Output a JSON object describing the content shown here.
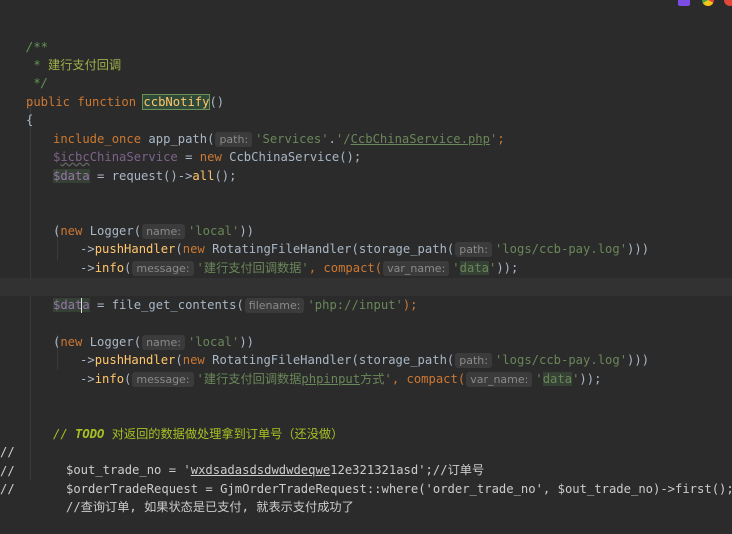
{
  "editor": {
    "doc_open": "/**",
    "doc_star": " * ",
    "doc_text": "建行支付回调",
    "doc_close": " */",
    "kw_public": "public",
    "kw_function": "function",
    "fn_name": "ccbNotify",
    "fn_parens": "()",
    "brace_open": "{",
    "line_include": {
      "kw": "include_once",
      "call": " app_path(",
      "hint": "path:",
      "str1": "'Services'",
      "concat": ".",
      "str2_quote": "'/",
      "str2_link": "CcbChinaService.php",
      "str2_close": "'",
      "end": ";"
    },
    "line_service": {
      "var_prefix": "$",
      "var_wavy": "icbc",
      "var_rest": "ChinaService",
      "eq": " = ",
      "kw_new": "new",
      "cls": " CcbChinaService();"
    },
    "line_request": {
      "var": "$data",
      "eq": " = request()->",
      "method": "all",
      "end": "();"
    },
    "logger1": {
      "open": "(",
      "kw_new": "new",
      "cls": " Logger(",
      "hint_name": "name:",
      "name_str": "'local'",
      "close": "))",
      "arrow1": "->",
      "m_push": "pushHandler",
      "push_open": "(",
      "kw_new2": "new",
      "handler": " RotatingFileHandler(storage_path(",
      "hint_path": "path:",
      "path_str": "'logs/ccb-pay.log'",
      "push_close": ")))",
      "arrow2": "->",
      "m_info": "info",
      "info_open": "(",
      "hint_msg": "message:",
      "msg_str": "'建行支付回调数据'",
      "comma": ", compact(",
      "hint_var": "var_name:",
      "var_q1": "'",
      "var_word": "data",
      "var_q2": "'",
      "info_close": "));"
    },
    "line_input": {
      "var_a": "$dat",
      "var_b": "a",
      "eq": " = file_get_contents(",
      "hint": "filename:",
      "str": "'php://input'",
      "end": ");"
    },
    "logger2": {
      "open": "(",
      "kw_new": "new",
      "cls": " Logger(",
      "hint_name": "name:",
      "name_str": "'local'",
      "close": "))",
      "arrow1": "->",
      "m_push": "pushHandler",
      "push_open": "(",
      "kw_new2": "new",
      "handler": " RotatingFileHandler(storage_path(",
      "hint_path": "path:",
      "path_str": "'logs/ccb-pay.log'",
      "push_close": ")))",
      "arrow2": "->",
      "m_info": "info",
      "info_open": "(",
      "hint_msg": "message:",
      "msg_str_a": "'建行支付回调数据",
      "msg_str_u": "phpinput",
      "msg_str_b": "方式'",
      "comma": ", compact(",
      "hint_var": "var_name:",
      "var_q1": "'",
      "var_word": "data",
      "var_q2": "'",
      "info_close": "));"
    },
    "todo_line": {
      "slashes": "// ",
      "todo": "TODO",
      "text": " 对返回的数据做处理拿到订单号（还没做）"
    },
    "commented": [
      {
        "gutter": "//",
        "code_a": "$out_trade_no = '",
        "code_u": "wxdsadasdsdwdwdeqwe",
        "code_b": "12e321321asd';//订单号"
      },
      {
        "gutter": "//",
        "code": "$orderTradeRequest = GjmOrderTradeRequest::where('order_trade_no', $out_trade_no)->first();"
      },
      {
        "gutter": "//",
        "code": "//查询订单, 如果状态是已支付, 就表示支付成功了"
      }
    ]
  },
  "corner_icons": [
    {
      "icon": "phpstorm-icon",
      "color": "#7b4be3"
    },
    {
      "icon": "chrome-icon",
      "color": "#3fa34d"
    },
    {
      "icon": "close-red-icon",
      "color": "#e2463d"
    }
  ]
}
